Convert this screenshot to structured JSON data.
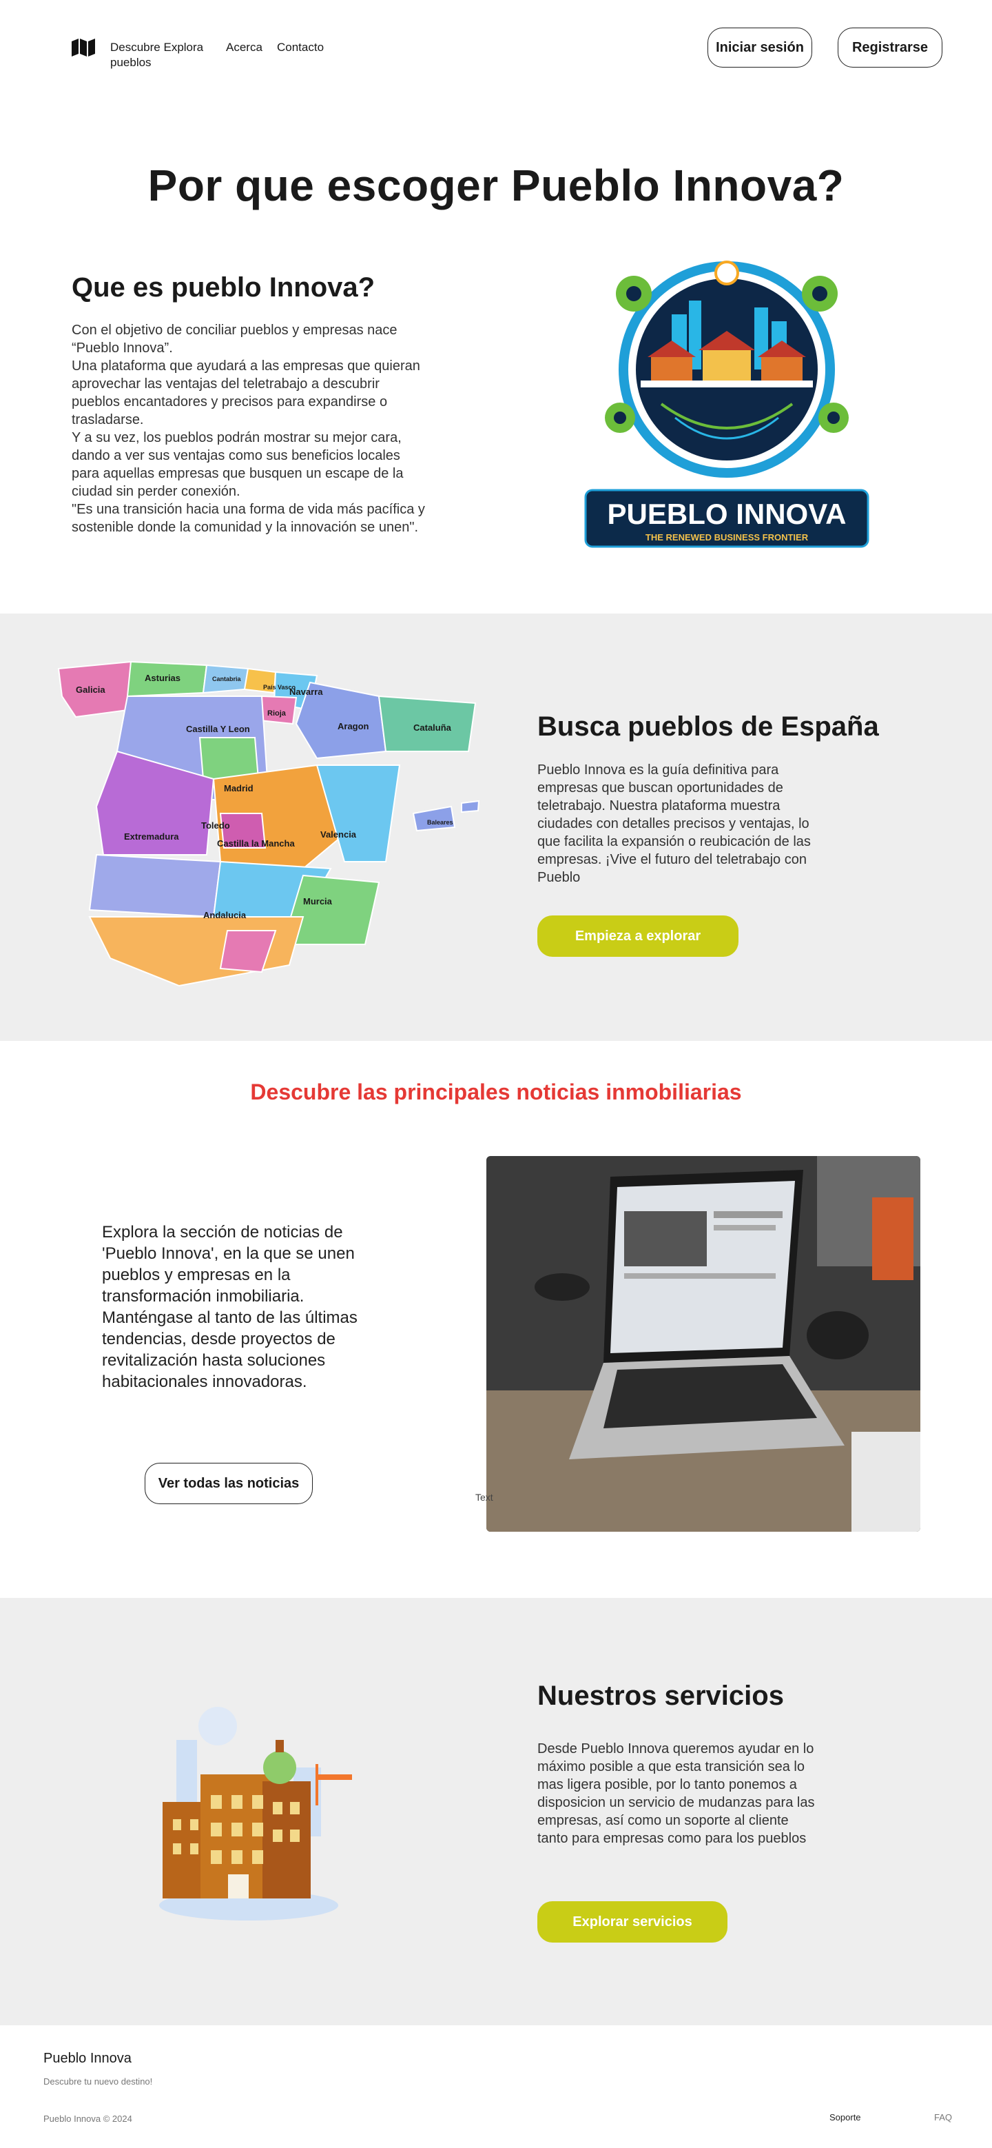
{
  "nav": {
    "links": [
      "Descubre Explora pueblos",
      "Acerca",
      "Contacto"
    ],
    "login_label": "Iniciar sesión",
    "signup_label": "Registrarse"
  },
  "hero": {
    "title": "Por que escoger Pueblo Innova?",
    "what_title": "Que es pueblo Innova?",
    "paragraphs": [
      "Con el objetivo de conciliar pueblos y empresas nace “Pueblo Innova”.",
      "Una plataforma que ayudará a las empresas que quieran aprovechar las ventajas del teletrabajo a descubrir pueblos encantadores y precisos para expandirse o trasladarse.",
      "Y a su vez, los pueblos podrán mostrar su mejor cara, dando a ver sus ventajas como sus beneficios locales para aquellas empresas que busquen un escape de la ciudad sin perder conexión.",
      "\"Es una transición hacia una forma de vida más pacífica y sostenible donde la comunidad y la innovación se unen\"."
    ],
    "logo_title": "PUEBLO INNOVA",
    "logo_subtitle": "THE RENEWED BUSINESS FRONTIER"
  },
  "map_section": {
    "title": "Busca pueblos de España",
    "text": "Pueblo Innova es la guía definitiva para empresas que buscan oportunidades de teletrabajo. Nuestra plataforma muestra ciudades con detalles precisos y ventajas, lo que facilita la expansión o reubicación de las empresas. ¡Vive el futuro del teletrabajo con Pueblo",
    "cta": "Empieza a explorar",
    "regions": [
      "Galicia",
      "Asturias",
      "Cantabria",
      "País Vasco",
      "Navarra",
      "Rioja",
      "Aragon",
      "Cataluña",
      "Castilla Y Leon",
      "Madrid",
      "Extremadura",
      "Toledo",
      "Castilla la Mancha",
      "Valencia",
      "Murcia",
      "Andalucia",
      "Baleares"
    ]
  },
  "news": {
    "heading": "Descubre las principales noticias inmobiliarias",
    "text": "Explora la sección de noticias de 'Pueblo Innova', en la que se unen pueblos y empresas en la transformación inmobiliaria. Manténgase al tanto de las últimas tendencias, desde proyectos de revitalización hasta soluciones habitacionales innovadoras.",
    "cta": "Ver todas las noticias",
    "image_caption": "Text"
  },
  "services": {
    "title": "Nuestros servicios",
    "text": "Desde Pueblo Innova queremos ayudar en lo máximo posible a que esta transición sea lo mas ligera posible, por lo tanto ponemos a disposicion un servicio de mudanzas para las empresas, así como un soporte al cliente tanto para empresas como para los pueblos",
    "cta": "Explorar servicios"
  },
  "footer": {
    "name": "Pueblo Innova",
    "tagline": "Descubre tu nuevo destino!",
    "copyright": "Pueblo Innova © 2024",
    "support": "Soporte",
    "faq": "FAQ"
  },
  "colors": {
    "accent": "#c9cd16",
    "news_heading": "#e53935",
    "section_bg": "#eeeeee"
  }
}
